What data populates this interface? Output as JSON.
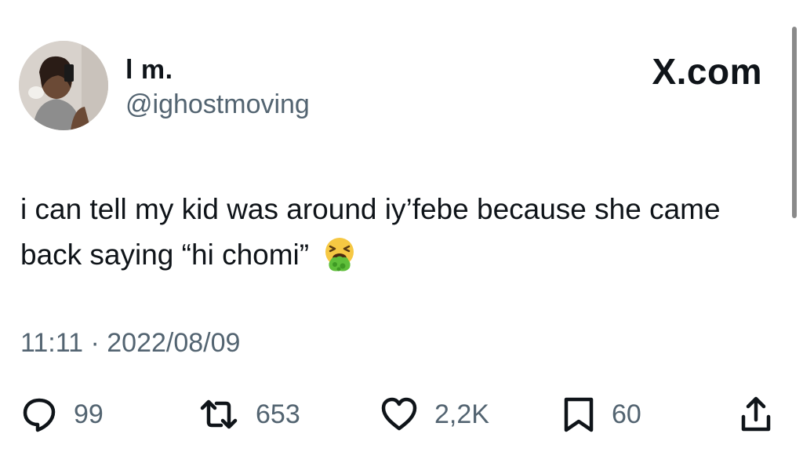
{
  "author": {
    "display_name": "l m.",
    "handle": "@ighostmoving"
  },
  "brand": "X.com",
  "tweet": {
    "text": "i can tell my kid was around iy’febe because she came back saying “hi chomi”",
    "emoji": "vomiting-face",
    "timestamp": "11:11 · 2022/08/09"
  },
  "actions": {
    "replies": "99",
    "reposts": "653",
    "likes": "2,2K",
    "bookmarks": "60"
  },
  "colors": {
    "text": "#0f1419",
    "secondary": "#536471",
    "background": "#ffffff"
  }
}
